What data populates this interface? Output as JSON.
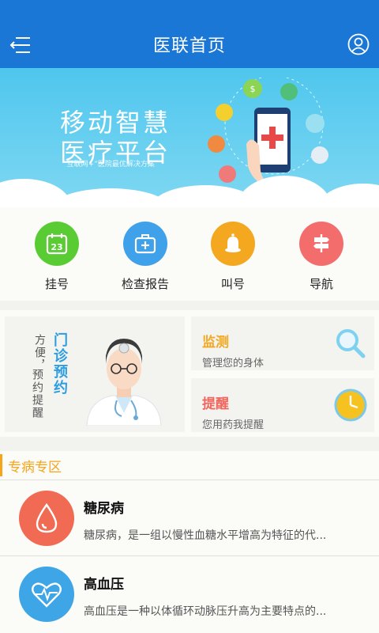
{
  "header": {
    "title": "医联首页",
    "menu_icon": "menu-icon",
    "profile_icon": "user-icon",
    "background": "#1b77d6"
  },
  "banner": {
    "line1": "移动智慧",
    "line2": "医疗平台",
    "subtitle": "“互联网+”医院最优解决方案"
  },
  "quick_actions": [
    {
      "label": "挂号",
      "icon": "calendar-icon",
      "icon_text": "23",
      "color": "#59cc34"
    },
    {
      "label": "检查报告",
      "icon": "medical-kit-icon",
      "color": "#3ea1ea"
    },
    {
      "label": "叫号",
      "icon": "bell-icon",
      "color": "#f3a820"
    },
    {
      "label": "导航",
      "icon": "signpost-icon",
      "color": "#f46d6d"
    }
  ],
  "feature_cards": {
    "appointment": {
      "title": "门诊预约",
      "subtitle_col1": "方便，",
      "subtitle_col2": "预约提醒"
    },
    "monitor": {
      "title": "监测",
      "desc": "管理您的身体",
      "color": "#f3a820"
    },
    "reminder": {
      "title": "提醒",
      "desc": "您用药我提醒",
      "color": "#f0665d"
    }
  },
  "special_section": {
    "title": "专病专区",
    "items": [
      {
        "name": "糖尿病",
        "desc": "糖尿病，是一组以慢性血糖水平增高为特征的代...",
        "color": "#f16a54",
        "icon": "blood-drop-icon"
      },
      {
        "name": "高血压",
        "desc": "高血压是一种以体循环动脉压升高为主要特点的...",
        "color": "#3ea6e6",
        "icon": "heartbeat-icon"
      }
    ]
  }
}
